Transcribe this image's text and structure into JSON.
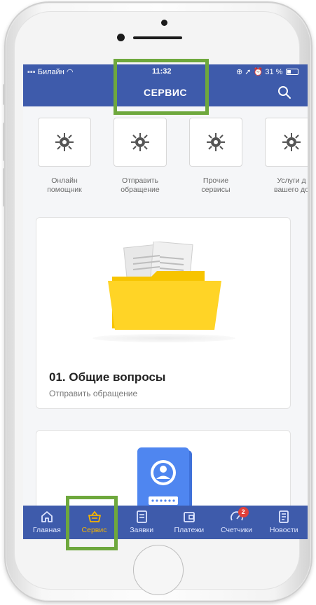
{
  "status_bar": {
    "carrier": "Билайн",
    "time": "11:32",
    "battery": "31 %"
  },
  "app_bar": {
    "title": "СЕРВИС"
  },
  "quick_actions": [
    {
      "label": "Онлайн\nпомощник"
    },
    {
      "label": "Отправить\nобращение"
    },
    {
      "label": "Прочие\nсервисы"
    },
    {
      "label": "Услуги д\nвашего до"
    }
  ],
  "cards": [
    {
      "title": "01. Общие вопросы",
      "subtitle": "Отправить обращение"
    }
  ],
  "tab_bar": {
    "items": [
      {
        "label": "Главная",
        "icon": "home-icon"
      },
      {
        "label": "Сервис",
        "icon": "basket-icon",
        "active": true
      },
      {
        "label": "Заявки",
        "icon": "requests-icon"
      },
      {
        "label": "Платежи",
        "icon": "wallet-icon"
      },
      {
        "label": "Счетчики",
        "icon": "gauge-icon",
        "badge": "2"
      },
      {
        "label": "Новости",
        "icon": "news-icon"
      }
    ]
  },
  "colors": {
    "primary": "#3e5bab",
    "accent": "#f5b400",
    "badge": "#e0403a",
    "highlight": "#6ea83d"
  }
}
